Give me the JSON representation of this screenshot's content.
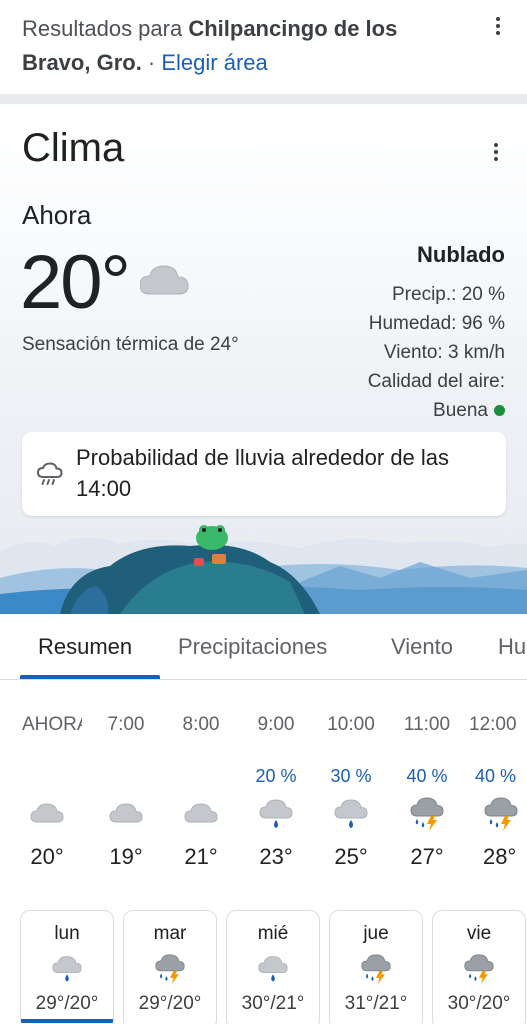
{
  "results": {
    "prefix": "Resultados para ",
    "location": "Chilpancingo de los Bravo, Gro.",
    "separator": " · ",
    "choose_area": "Elegir área"
  },
  "weather": {
    "title": "Clima",
    "now_label": "Ahora",
    "temp": "20°",
    "condition": "Nublado",
    "feels_like": "Sensación térmica de 24°",
    "precip": "Precip.: 20 %",
    "humidity": "Humedad: 96 %",
    "wind": "Viento: 3 km/h",
    "air_quality_label": "Calidad del aire:",
    "air_quality_value": "Buena",
    "rain_alert": "Probabilidad de lluvia alrededor de las 14:00"
  },
  "tabs": [
    "Resumen",
    "Precipitaciones",
    "Viento",
    "Hu"
  ],
  "hourly": [
    {
      "time": "AHORA",
      "precip": "",
      "icon": "cloud-icon",
      "temp": "20°"
    },
    {
      "time": "7:00",
      "precip": "",
      "icon": "cloud-icon",
      "temp": "19°"
    },
    {
      "time": "8:00",
      "precip": "",
      "icon": "cloud-icon",
      "temp": "21°"
    },
    {
      "time": "9:00",
      "precip": "20 %",
      "icon": "cloud-rain-icon",
      "temp": "23°"
    },
    {
      "time": "10:00",
      "precip": "30 %",
      "icon": "cloud-rain-icon",
      "temp": "25°"
    },
    {
      "time": "11:00",
      "precip": "40 %",
      "icon": "thunderstorm-icon",
      "temp": "27°"
    },
    {
      "time": "12:00",
      "precip": "40 %",
      "icon": "thunderstorm-icon",
      "temp": "28°"
    }
  ],
  "daily": [
    {
      "day": "lun",
      "icon": "cloud-rain-icon",
      "temps": "29°/20°",
      "selected": true
    },
    {
      "day": "mar",
      "icon": "thunderstorm-icon",
      "temps": "29°/20°",
      "selected": false
    },
    {
      "day": "mié",
      "icon": "cloud-rain-icon",
      "temps": "30°/21°",
      "selected": false
    },
    {
      "day": "jue",
      "icon": "thunderstorm-icon",
      "temps": "31°/21°",
      "selected": false
    },
    {
      "day": "vie",
      "icon": "thunderstorm-icon",
      "temps": "30°/20°",
      "selected": false
    }
  ],
  "colors": {
    "accent": "#1a5fb4",
    "air_quality_good": "#1e8e3e",
    "lightning": "#f29900",
    "rain_drop": "#1a5fb4"
  }
}
